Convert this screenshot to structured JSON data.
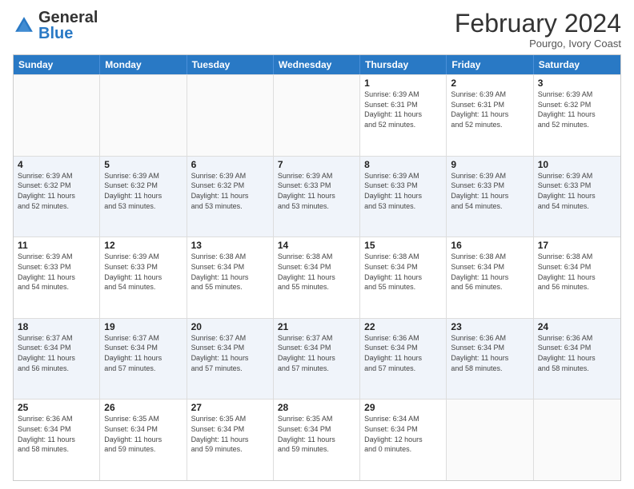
{
  "logo": {
    "general": "General",
    "blue": "Blue"
  },
  "header": {
    "title": "February 2024",
    "subtitle": "Pourgo, Ivory Coast"
  },
  "weekdays": [
    "Sunday",
    "Monday",
    "Tuesday",
    "Wednesday",
    "Thursday",
    "Friday",
    "Saturday"
  ],
  "rows": [
    [
      {
        "day": "",
        "info": ""
      },
      {
        "day": "",
        "info": ""
      },
      {
        "day": "",
        "info": ""
      },
      {
        "day": "",
        "info": ""
      },
      {
        "day": "1",
        "info": "Sunrise: 6:39 AM\nSunset: 6:31 PM\nDaylight: 11 hours\nand 52 minutes."
      },
      {
        "day": "2",
        "info": "Sunrise: 6:39 AM\nSunset: 6:31 PM\nDaylight: 11 hours\nand 52 minutes."
      },
      {
        "day": "3",
        "info": "Sunrise: 6:39 AM\nSunset: 6:32 PM\nDaylight: 11 hours\nand 52 minutes."
      }
    ],
    [
      {
        "day": "4",
        "info": "Sunrise: 6:39 AM\nSunset: 6:32 PM\nDaylight: 11 hours\nand 52 minutes."
      },
      {
        "day": "5",
        "info": "Sunrise: 6:39 AM\nSunset: 6:32 PM\nDaylight: 11 hours\nand 53 minutes."
      },
      {
        "day": "6",
        "info": "Sunrise: 6:39 AM\nSunset: 6:32 PM\nDaylight: 11 hours\nand 53 minutes."
      },
      {
        "day": "7",
        "info": "Sunrise: 6:39 AM\nSunset: 6:33 PM\nDaylight: 11 hours\nand 53 minutes."
      },
      {
        "day": "8",
        "info": "Sunrise: 6:39 AM\nSunset: 6:33 PM\nDaylight: 11 hours\nand 53 minutes."
      },
      {
        "day": "9",
        "info": "Sunrise: 6:39 AM\nSunset: 6:33 PM\nDaylight: 11 hours\nand 54 minutes."
      },
      {
        "day": "10",
        "info": "Sunrise: 6:39 AM\nSunset: 6:33 PM\nDaylight: 11 hours\nand 54 minutes."
      }
    ],
    [
      {
        "day": "11",
        "info": "Sunrise: 6:39 AM\nSunset: 6:33 PM\nDaylight: 11 hours\nand 54 minutes."
      },
      {
        "day": "12",
        "info": "Sunrise: 6:39 AM\nSunset: 6:33 PM\nDaylight: 11 hours\nand 54 minutes."
      },
      {
        "day": "13",
        "info": "Sunrise: 6:38 AM\nSunset: 6:34 PM\nDaylight: 11 hours\nand 55 minutes."
      },
      {
        "day": "14",
        "info": "Sunrise: 6:38 AM\nSunset: 6:34 PM\nDaylight: 11 hours\nand 55 minutes."
      },
      {
        "day": "15",
        "info": "Sunrise: 6:38 AM\nSunset: 6:34 PM\nDaylight: 11 hours\nand 55 minutes."
      },
      {
        "day": "16",
        "info": "Sunrise: 6:38 AM\nSunset: 6:34 PM\nDaylight: 11 hours\nand 56 minutes."
      },
      {
        "day": "17",
        "info": "Sunrise: 6:38 AM\nSunset: 6:34 PM\nDaylight: 11 hours\nand 56 minutes."
      }
    ],
    [
      {
        "day": "18",
        "info": "Sunrise: 6:37 AM\nSunset: 6:34 PM\nDaylight: 11 hours\nand 56 minutes."
      },
      {
        "day": "19",
        "info": "Sunrise: 6:37 AM\nSunset: 6:34 PM\nDaylight: 11 hours\nand 57 minutes."
      },
      {
        "day": "20",
        "info": "Sunrise: 6:37 AM\nSunset: 6:34 PM\nDaylight: 11 hours\nand 57 minutes."
      },
      {
        "day": "21",
        "info": "Sunrise: 6:37 AM\nSunset: 6:34 PM\nDaylight: 11 hours\nand 57 minutes."
      },
      {
        "day": "22",
        "info": "Sunrise: 6:36 AM\nSunset: 6:34 PM\nDaylight: 11 hours\nand 57 minutes."
      },
      {
        "day": "23",
        "info": "Sunrise: 6:36 AM\nSunset: 6:34 PM\nDaylight: 11 hours\nand 58 minutes."
      },
      {
        "day": "24",
        "info": "Sunrise: 6:36 AM\nSunset: 6:34 PM\nDaylight: 11 hours\nand 58 minutes."
      }
    ],
    [
      {
        "day": "25",
        "info": "Sunrise: 6:36 AM\nSunset: 6:34 PM\nDaylight: 11 hours\nand 58 minutes."
      },
      {
        "day": "26",
        "info": "Sunrise: 6:35 AM\nSunset: 6:34 PM\nDaylight: 11 hours\nand 59 minutes."
      },
      {
        "day": "27",
        "info": "Sunrise: 6:35 AM\nSunset: 6:34 PM\nDaylight: 11 hours\nand 59 minutes."
      },
      {
        "day": "28",
        "info": "Sunrise: 6:35 AM\nSunset: 6:34 PM\nDaylight: 11 hours\nand 59 minutes."
      },
      {
        "day": "29",
        "info": "Sunrise: 6:34 AM\nSunset: 6:34 PM\nDaylight: 12 hours\nand 0 minutes."
      },
      {
        "day": "",
        "info": ""
      },
      {
        "day": "",
        "info": ""
      }
    ]
  ]
}
